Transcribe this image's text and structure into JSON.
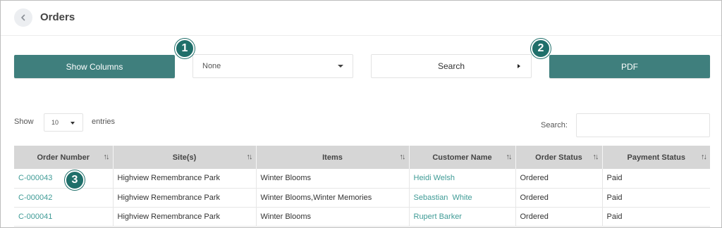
{
  "header": {
    "title": "Orders"
  },
  "toolbar": {
    "show_columns_label": "Show Columns",
    "select_value": "None",
    "search_label": "Search",
    "pdf_label": "PDF"
  },
  "callouts": {
    "one": "1",
    "two": "2",
    "three": "3"
  },
  "length": {
    "show_label": "Show",
    "value": "10",
    "entries_label": "entries"
  },
  "filter": {
    "label": "Search:",
    "value": ""
  },
  "table": {
    "columns": [
      "Order Number",
      "Site(s)",
      "Items",
      "Customer Name",
      "Order Status",
      "Payment Status"
    ],
    "sort_icon": "↑↓",
    "rows": [
      {
        "order": "C-000043",
        "site": "Highview Remembrance Park",
        "items": "Winter Blooms",
        "customer": "Heidi Welsh",
        "order_status": "Ordered",
        "payment": "Paid"
      },
      {
        "order": "C-000042",
        "site": "Highview Remembrance Park",
        "items": "Winter Blooms,Winter Memories",
        "customer": "Sebastian  White",
        "order_status": "Ordered",
        "payment": "Paid"
      },
      {
        "order": "C-000041",
        "site": "Highview Remembrance Park",
        "items": "Winter Blooms",
        "customer": "Rupert Barker",
        "order_status": "Ordered",
        "payment": "Paid"
      }
    ]
  },
  "colors": {
    "accent": "#3f7f7d",
    "badge": "#1f6f6a",
    "link": "#3f9b96",
    "table_header": "#d6d6d6"
  },
  "icons": {
    "back": "chevron-left-icon",
    "dropdown": "caret-down-icon",
    "search_arrow": "caret-right-icon",
    "sort": "sort-arrows-icon"
  }
}
